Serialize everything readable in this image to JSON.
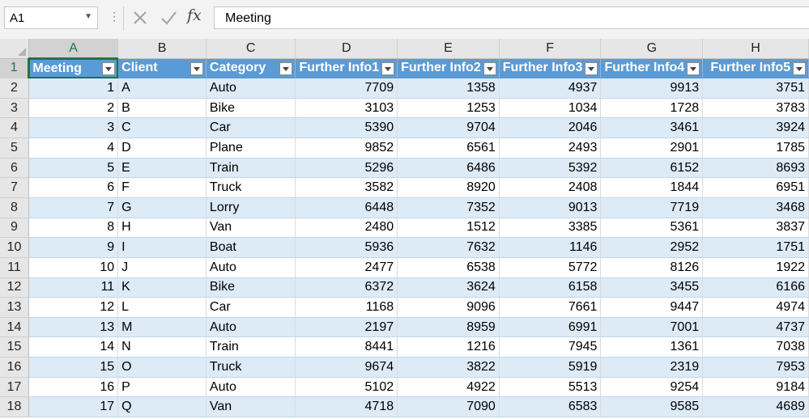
{
  "formula_bar": {
    "name_box": "A1",
    "fx_label": "fx",
    "formula": "Meeting"
  },
  "columns": [
    "A",
    "B",
    "C",
    "D",
    "E",
    "F",
    "G",
    "H"
  ],
  "selected_column": "A",
  "selected_row": "1",
  "table": {
    "headers": [
      "Meeting",
      "Client",
      "Category",
      "Further Info1",
      "Further Info2",
      "Further Info3",
      "Further Info4",
      "Further Info5"
    ],
    "rows": [
      {
        "row": "2",
        "cells": [
          "1",
          "A",
          "Auto",
          "7709",
          "1358",
          "4937",
          "9913",
          "3751"
        ]
      },
      {
        "row": "3",
        "cells": [
          "2",
          "B",
          "Bike",
          "3103",
          "1253",
          "1034",
          "1728",
          "3783"
        ]
      },
      {
        "row": "4",
        "cells": [
          "3",
          "C",
          "Car",
          "5390",
          "9704",
          "2046",
          "3461",
          "3924"
        ]
      },
      {
        "row": "5",
        "cells": [
          "4",
          "D",
          "Plane",
          "9852",
          "6561",
          "2493",
          "2901",
          "1785"
        ]
      },
      {
        "row": "6",
        "cells": [
          "5",
          "E",
          "Train",
          "5296",
          "6486",
          "5392",
          "6152",
          "8693"
        ]
      },
      {
        "row": "7",
        "cells": [
          "6",
          "F",
          "Truck",
          "3582",
          "8920",
          "2408",
          "1844",
          "6951"
        ]
      },
      {
        "row": "8",
        "cells": [
          "7",
          "G",
          "Lorry",
          "6448",
          "7352",
          "9013",
          "7719",
          "3468"
        ]
      },
      {
        "row": "9",
        "cells": [
          "8",
          "H",
          "Van",
          "2480",
          "1512",
          "3385",
          "5361",
          "3837"
        ]
      },
      {
        "row": "10",
        "cells": [
          "9",
          "I",
          "Boat",
          "5936",
          "7632",
          "1146",
          "2952",
          "1751"
        ]
      },
      {
        "row": "11",
        "cells": [
          "10",
          "J",
          "Auto",
          "2477",
          "6538",
          "5772",
          "8126",
          "1922"
        ]
      },
      {
        "row": "12",
        "cells": [
          "11",
          "K",
          "Bike",
          "6372",
          "3624",
          "6158",
          "3455",
          "6166"
        ]
      },
      {
        "row": "13",
        "cells": [
          "12",
          "L",
          "Car",
          "1168",
          "9096",
          "7661",
          "9447",
          "4974"
        ]
      },
      {
        "row": "14",
        "cells": [
          "13",
          "M",
          "Auto",
          "2197",
          "8959",
          "6991",
          "7001",
          "4737"
        ]
      },
      {
        "row": "15",
        "cells": [
          "14",
          "N",
          "Train",
          "8441",
          "1216",
          "7945",
          "1361",
          "7038"
        ]
      },
      {
        "row": "16",
        "cells": [
          "15",
          "O",
          "Truck",
          "9674",
          "3822",
          "5919",
          "2319",
          "7953"
        ]
      },
      {
        "row": "17",
        "cells": [
          "16",
          "P",
          "Auto",
          "5102",
          "4922",
          "5513",
          "9254",
          "9184"
        ]
      },
      {
        "row": "18",
        "cells": [
          "17",
          "Q",
          "Van",
          "4718",
          "7090",
          "6583",
          "9585",
          "4689"
        ]
      }
    ]
  },
  "colors": {
    "header_fill": "#5b9bd5",
    "band_fill": "#ddebf7",
    "selection": "#217346"
  }
}
